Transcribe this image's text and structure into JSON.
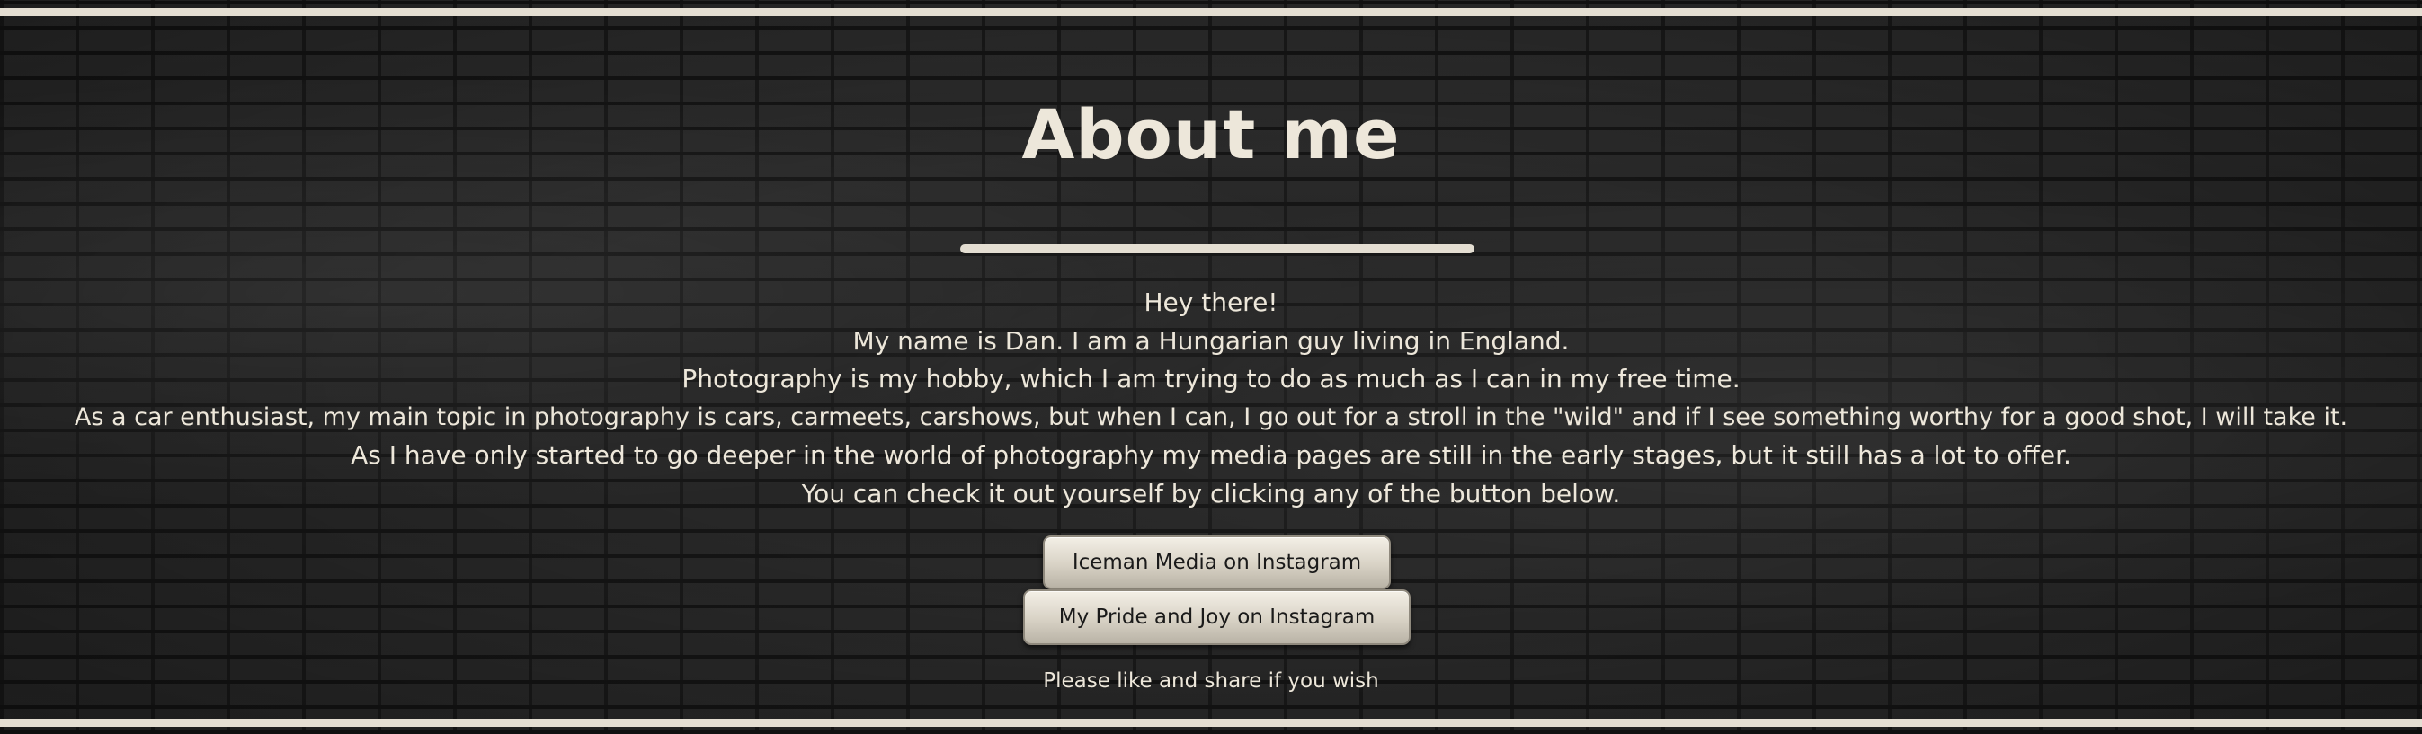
{
  "page": {
    "title": "About me"
  },
  "about": {
    "lines": [
      "Hey there!",
      "My name is Dan. I am a Hungarian guy living in England.",
      "Photography is my hobby, which I am trying to do as much as I can in my free time.",
      "As a car enthusiast, my main topic in photography is cars, carmeets, carshows, but when I can, I go out for a stroll in the \"wild\" and if I see something worthy for a good shot, I will take it.",
      "As I have only started to go deeper in the world of photography my media pages are still in the early stages, but it still has a lot to offer.",
      "You can check it out yourself by clicking any of the button below."
    ]
  },
  "buttons": {
    "iceman_media": "Iceman Media on Instagram",
    "pride_and_joy": "My Pride and Joy on Instagram"
  },
  "footer": {
    "note": "Please like and share if you wish"
  },
  "colors": {
    "text": "#ede7da",
    "frame": "#e4ded2",
    "background": "#262626"
  }
}
